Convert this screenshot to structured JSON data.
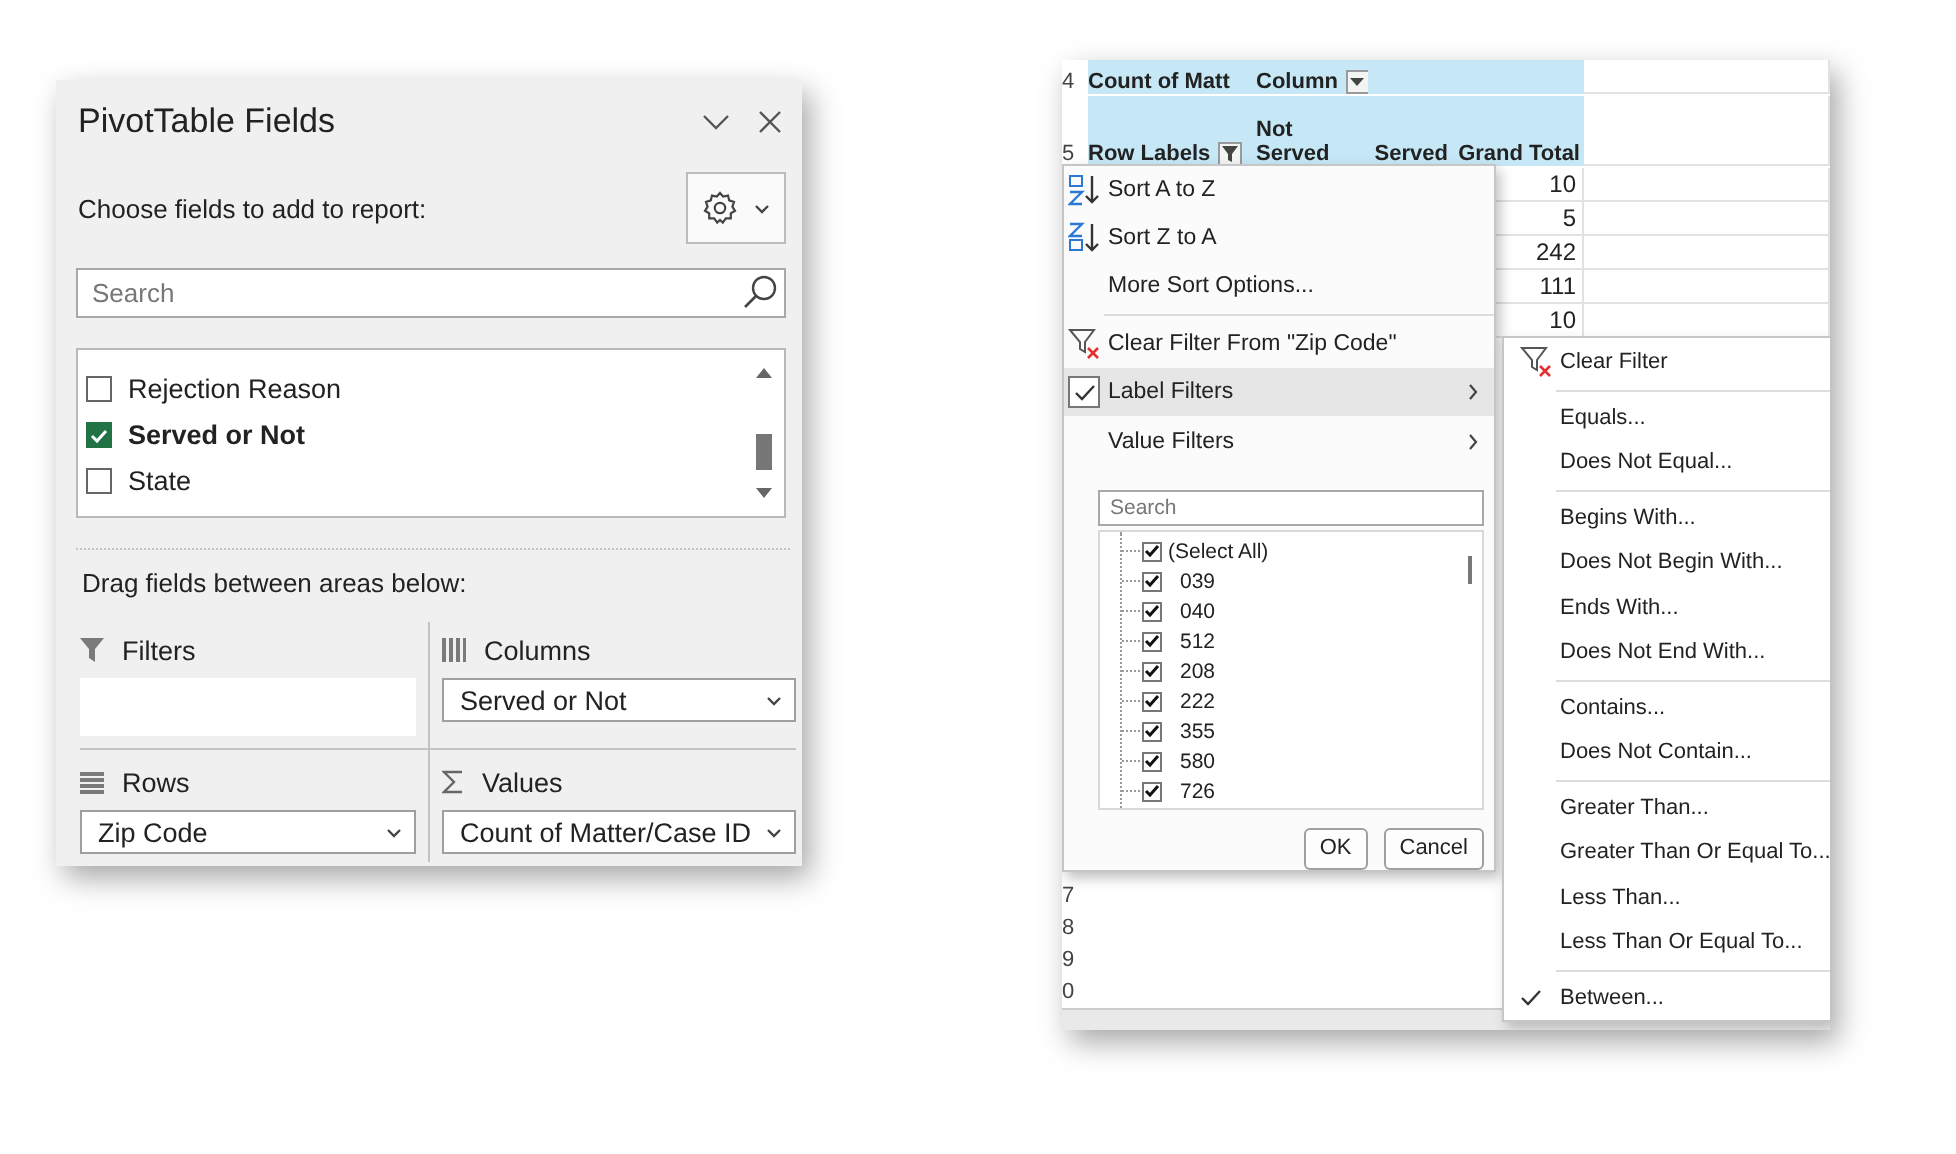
{
  "field_list": {
    "title": "PivotTable Fields",
    "subtitle": "Choose fields to add to report:",
    "search": {
      "placeholder": "Search"
    },
    "fields": [
      {
        "label": "Rejection Reason",
        "checked": false
      },
      {
        "label": "Served or Not",
        "checked": true
      },
      {
        "label": "State",
        "checked": false
      }
    ],
    "areas_hint": "Drag fields between areas below:",
    "areas": [
      {
        "kind": "filters",
        "label": "Filters"
      },
      {
        "kind": "columns",
        "label": "Columns",
        "field": "Served or Not"
      },
      {
        "kind": "rows",
        "label": "Rows",
        "field": "Zip Code"
      },
      {
        "kind": "values",
        "label": "Values",
        "field": "Count of Matter/Case ID"
      }
    ]
  },
  "sheet": {
    "top_row_numbers": [
      "4",
      "5"
    ],
    "pivot": {
      "value_field": "Count of Matt",
      "column_field": "Column",
      "row_field": "Row Labels",
      "columns": [
        "Not\nServed",
        "Served",
        "Grand Total"
      ]
    },
    "grand_totals": [
      "10",
      "5",
      "242",
      "111",
      "10"
    ],
    "bottom_row_numbers": [
      "7",
      "8",
      "9",
      "0"
    ]
  },
  "filter_menu": {
    "items": [
      {
        "kind": "sort-asc",
        "label": "Sort A to Z"
      },
      {
        "kind": "sort-desc",
        "label": "Sort Z to A"
      },
      {
        "kind": "plain",
        "label": "More Sort Options..."
      },
      {
        "kind": "separator"
      },
      {
        "kind": "clear-filter",
        "label": "Clear Filter From \"Zip Code\""
      },
      {
        "kind": "submenu",
        "label": "Label Filters",
        "checked": true,
        "selected": true
      },
      {
        "kind": "submenu",
        "label": "Value Filters",
        "checked": false,
        "selected": false
      }
    ],
    "search": {
      "placeholder": "Search"
    },
    "values": [
      {
        "label": "(Select All)",
        "checked": true
      },
      {
        "label": "039",
        "checked": true
      },
      {
        "label": "040",
        "checked": true
      },
      {
        "label": "512",
        "checked": true
      },
      {
        "label": "208",
        "checked": true
      },
      {
        "label": "222",
        "checked": true
      },
      {
        "label": "355",
        "checked": true
      },
      {
        "label": "580",
        "checked": true
      },
      {
        "label": "726",
        "checked": true
      }
    ],
    "buttons": [
      "OK",
      "Cancel"
    ]
  },
  "label_filters_menu": {
    "items": [
      {
        "kind": "clear-filter",
        "label": "Clear Filter"
      },
      {
        "kind": "separator"
      },
      {
        "kind": "plain",
        "label": "Equals...",
        "checked": false
      },
      {
        "kind": "plain",
        "label": "Does Not Equal...",
        "checked": false
      },
      {
        "kind": "separator"
      },
      {
        "kind": "plain",
        "label": "Begins With...",
        "checked": false
      },
      {
        "kind": "plain",
        "label": "Does Not Begin With...",
        "checked": false
      },
      {
        "kind": "plain",
        "label": "Ends With...",
        "checked": false
      },
      {
        "kind": "plain",
        "label": "Does Not End With...",
        "checked": false
      },
      {
        "kind": "separator"
      },
      {
        "kind": "plain",
        "label": "Contains...",
        "checked": false
      },
      {
        "kind": "plain",
        "label": "Does Not Contain...",
        "checked": false
      },
      {
        "kind": "separator"
      },
      {
        "kind": "plain",
        "label": "Greater Than...",
        "checked": false
      },
      {
        "kind": "plain",
        "label": "Greater Than Or Equal To...",
        "checked": false
      },
      {
        "kind": "plain",
        "label": "Less Than...",
        "checked": false
      },
      {
        "kind": "plain",
        "label": "Less Than Or Equal To...",
        "checked": false
      },
      {
        "kind": "separator"
      },
      {
        "kind": "plain",
        "label": "Between...",
        "checked": true
      }
    ]
  }
}
